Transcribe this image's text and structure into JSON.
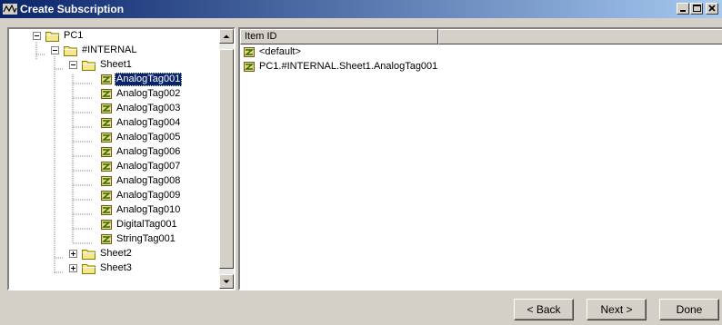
{
  "window": {
    "title": "Create Subscription",
    "buttons": {
      "minimize": "minimize-icon",
      "maximize": "maximize-icon",
      "close": "close-icon"
    }
  },
  "tree": {
    "root": {
      "label": "PC1",
      "expanded": true
    },
    "internal": {
      "label": "#INTERNAL",
      "expanded": true
    },
    "sheet1": {
      "label": "Sheet1",
      "expanded": true
    },
    "tags": [
      {
        "label": "AnalogTag001",
        "selected": true
      },
      {
        "label": "AnalogTag002"
      },
      {
        "label": "AnalogTag003"
      },
      {
        "label": "AnalogTag004"
      },
      {
        "label": "AnalogTag005"
      },
      {
        "label": "AnalogTag006"
      },
      {
        "label": "AnalogTag007"
      },
      {
        "label": "AnalogTag008"
      },
      {
        "label": "AnalogTag009"
      },
      {
        "label": "AnalogTag010"
      },
      {
        "label": "DigitalTag001"
      },
      {
        "label": "StringTag001"
      }
    ],
    "sheet2": {
      "label": "Sheet2",
      "expanded": false
    },
    "sheet3": {
      "label": "Sheet3",
      "expanded": false
    }
  },
  "list": {
    "columns": [
      "Item ID",
      ""
    ],
    "rows": [
      {
        "label": "<default>"
      },
      {
        "label": "PC1.#INTERNAL.Sheet1.AnalogTag001"
      }
    ]
  },
  "footer": {
    "back_label": "< Back",
    "next_label": "Next >",
    "done_label": "Done"
  },
  "colors": {
    "title_bar": "#0a246a",
    "selection": "#0a246a",
    "face": "#d4d0c8",
    "folder": "#f7e58f"
  }
}
